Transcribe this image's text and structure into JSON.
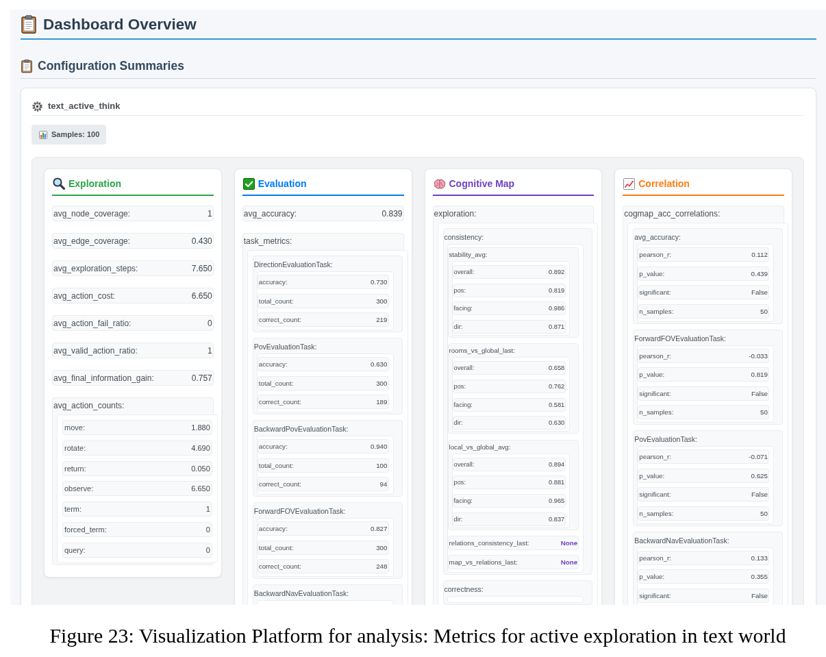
{
  "header": {
    "title": "Dashboard Overview"
  },
  "section": {
    "title": "Configuration Summaries"
  },
  "config": {
    "name": "text_active_think",
    "samples": "Samples: 100",
    "panels": [
      {
        "kind": "magnifier",
        "title": "Exploration",
        "color": "#28a745",
        "items": [
          {
            "kind": "row",
            "label": "avg_node_coverage:",
            "value": "1"
          },
          {
            "kind": "row",
            "label": "avg_edge_coverage:",
            "value": "0.430"
          },
          {
            "kind": "row",
            "label": "avg_exploration_steps:",
            "value": "7.650"
          },
          {
            "kind": "row",
            "label": "avg_action_cost:",
            "value": "6.650"
          },
          {
            "kind": "row",
            "label": "avg_action_fail_ratio:",
            "value": "0"
          },
          {
            "kind": "row",
            "label": "avg_valid_action_ratio:",
            "value": "1"
          },
          {
            "kind": "row",
            "label": "avg_final_information_gain:",
            "value": "0.757"
          },
          {
            "kind": "group",
            "label": "avg_action_counts:",
            "children": [
              {
                "kind": "row",
                "label": "move:",
                "value": "1.880"
              },
              {
                "kind": "row",
                "label": "rotate:",
                "value": "4.690"
              },
              {
                "kind": "row",
                "label": "return:",
                "value": "0.050"
              },
              {
                "kind": "row",
                "label": "observe:",
                "value": "6.650"
              },
              {
                "kind": "row",
                "label": "term:",
                "value": "1"
              },
              {
                "kind": "row",
                "label": "forced_term:",
                "value": "0"
              },
              {
                "kind": "row",
                "label": "query:",
                "value": "0"
              }
            ]
          }
        ]
      },
      {
        "kind": "checkbox",
        "title": "Evaluation",
        "color": "#007bff",
        "items": [
          {
            "kind": "row",
            "label": "avg_accuracy:",
            "value": "0.839"
          },
          {
            "kind": "group",
            "label": "task_metrics:",
            "children": [
              {
                "kind": "group",
                "label": "DirectionEvaluationTask:",
                "children": [
                  {
                    "kind": "row",
                    "label": "accuracy:",
                    "value": "0.730"
                  },
                  {
                    "kind": "row",
                    "label": "total_count:",
                    "value": "300"
                  },
                  {
                    "kind": "row",
                    "label": "correct_count:",
                    "value": "219"
                  }
                ]
              },
              {
                "kind": "group",
                "label": "PovEvaluationTask:",
                "children": [
                  {
                    "kind": "row",
                    "label": "accuracy:",
                    "value": "0.630"
                  },
                  {
                    "kind": "row",
                    "label": "total_count:",
                    "value": "300"
                  },
                  {
                    "kind": "row",
                    "label": "correct_count:",
                    "value": "189"
                  }
                ]
              },
              {
                "kind": "group",
                "label": "BackwardPovEvaluationTask:",
                "children": [
                  {
                    "kind": "row",
                    "label": "accuracy:",
                    "value": "0.940"
                  },
                  {
                    "kind": "row",
                    "label": "total_count:",
                    "value": "100"
                  },
                  {
                    "kind": "row",
                    "label": "correct_count:",
                    "value": "94"
                  }
                ]
              },
              {
                "kind": "group",
                "label": "ForwardFOVEvaluationTask:",
                "children": [
                  {
                    "kind": "row",
                    "label": "accuracy:",
                    "value": "0.827"
                  },
                  {
                    "kind": "row",
                    "label": "total_count:",
                    "value": "300"
                  },
                  {
                    "kind": "row",
                    "label": "correct_count:",
                    "value": "248"
                  }
                ]
              },
              {
                "kind": "group",
                "label": "BackwardNavEvaluationTask:"
              }
            ]
          }
        ]
      },
      {
        "kind": "brain",
        "title": "Cognitive Map",
        "color": "#6f42c1",
        "items": [
          {
            "kind": "group",
            "label": "exploration:",
            "children": [
              {
                "kind": "group",
                "label": "consistency:",
                "children": [
                  {
                    "kind": "group",
                    "label": "stability_avg:",
                    "children": [
                      {
                        "kind": "row",
                        "label": "overall:",
                        "value": "0.892"
                      },
                      {
                        "kind": "row",
                        "label": "pos:",
                        "value": "0.819"
                      },
                      {
                        "kind": "row",
                        "label": "facing:",
                        "value": "0.986"
                      },
                      {
                        "kind": "row",
                        "label": "dir:",
                        "value": "0.871"
                      }
                    ]
                  },
                  {
                    "kind": "group",
                    "label": "rooms_vs_global_last:",
                    "children": [
                      {
                        "kind": "row",
                        "label": "overall:",
                        "value": "0.658"
                      },
                      {
                        "kind": "row",
                        "label": "pos:",
                        "value": "0.762"
                      },
                      {
                        "kind": "row",
                        "label": "facing:",
                        "value": "0.581"
                      },
                      {
                        "kind": "row",
                        "label": "dir:",
                        "value": "0.630"
                      }
                    ]
                  },
                  {
                    "kind": "group",
                    "label": "local_vs_global_avg:",
                    "children": [
                      {
                        "kind": "row",
                        "label": "overall:",
                        "value": "0.894"
                      },
                      {
                        "kind": "row",
                        "label": "pos:",
                        "value": "0.881"
                      },
                      {
                        "kind": "row",
                        "label": "facing:",
                        "value": "0.965"
                      },
                      {
                        "kind": "row",
                        "label": "dir:",
                        "value": "0.837"
                      }
                    ]
                  },
                  {
                    "kind": "null",
                    "label": "relations_consistency_last:",
                    "value": "None"
                  },
                  {
                    "kind": "null",
                    "label": "map_vs_relations_last:",
                    "value": "None"
                  }
                ]
              },
              {
                "kind": "group",
                "label": "correctness:"
              }
            ]
          }
        ]
      },
      {
        "kind": "chart",
        "title": "Correlation",
        "color": "#fd7e14",
        "items": [
          {
            "kind": "group",
            "label": "cogmap_acc_correlations:",
            "children": [
              {
                "kind": "group",
                "label": "avg_accuracy:",
                "children": [
                  {
                    "kind": "row",
                    "label": "pearson_r:",
                    "value": "0.112"
                  },
                  {
                    "kind": "row",
                    "label": "p_value:",
                    "value": "0.439"
                  },
                  {
                    "kind": "row",
                    "label": "significant:",
                    "value": "False"
                  },
                  {
                    "kind": "row",
                    "label": "n_samples:",
                    "value": "50"
                  }
                ]
              },
              {
                "kind": "group",
                "label": "ForwardFOVEvaluationTask:",
                "children": [
                  {
                    "kind": "row",
                    "label": "pearson_r:",
                    "value": "-0.033"
                  },
                  {
                    "kind": "row",
                    "label": "p_value:",
                    "value": "0.819"
                  },
                  {
                    "kind": "row",
                    "label": "significant:",
                    "value": "False"
                  },
                  {
                    "kind": "row",
                    "label": "n_samples:",
                    "value": "50"
                  }
                ]
              },
              {
                "kind": "group",
                "label": "PovEvaluationTask:",
                "children": [
                  {
                    "kind": "row",
                    "label": "pearson_r:",
                    "value": "-0.071"
                  },
                  {
                    "kind": "row",
                    "label": "p_value:",
                    "value": "0.625"
                  },
                  {
                    "kind": "row",
                    "label": "significant:",
                    "value": "False"
                  },
                  {
                    "kind": "row",
                    "label": "n_samples:",
                    "value": "50"
                  }
                ]
              },
              {
                "kind": "group",
                "label": "BackwardNavEvaluationTask:",
                "children": [
                  {
                    "kind": "row",
                    "label": "pearson_r:",
                    "value": "0.133"
                  },
                  {
                    "kind": "row",
                    "label": "p_value:",
                    "value": "0.355"
                  },
                  {
                    "kind": "row",
                    "label": "significant:",
                    "value": "False"
                  }
                ]
              }
            ]
          }
        ]
      }
    ]
  },
  "caption": "Figure 23: Visualization Platform for analysis: Metrics for active exploration in text world"
}
